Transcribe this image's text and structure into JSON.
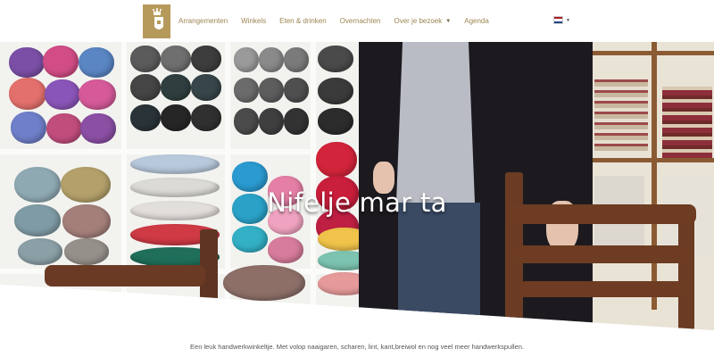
{
  "brand": {
    "logo_icon": "castle-crest-icon",
    "color": "#b69a5c"
  },
  "nav": {
    "items": [
      {
        "label": "Arrangementen"
      },
      {
        "label": "Winkels"
      },
      {
        "label": "Eten & drinken"
      },
      {
        "label": "Overnachten"
      },
      {
        "label": "Over je bezoek",
        "has_dropdown": true
      },
      {
        "label": "Agenda"
      }
    ],
    "text_color": "#9c8552"
  },
  "language": {
    "selected": "nl",
    "icon": "dutch-flag-icon"
  },
  "hero": {
    "title": "Nifelje mar ta"
  },
  "intro": {
    "text": "Een leuk handwerkwinkeltje. Met volop naaigaren, scharen, lint, kant,breiwol en nog veel meer handwerkspullen."
  }
}
